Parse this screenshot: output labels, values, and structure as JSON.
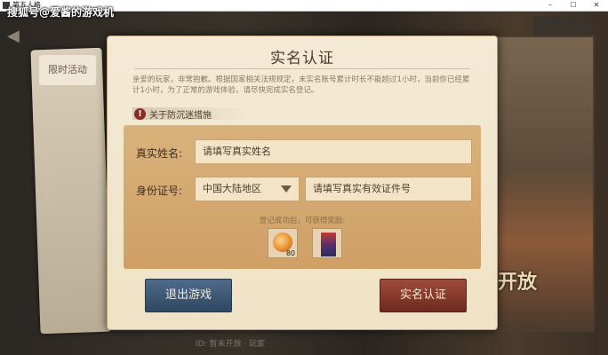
{
  "window": {
    "title": "第五人格",
    "minimize": "–",
    "maximize": "☐",
    "close": "✕"
  },
  "watermark": "搜狐号@爱酱的游戏机",
  "background": {
    "side_tab_label": "限时活动",
    "right_banner_text": "开放",
    "bottom_caption": "ID: 暂未开放 · 玩家"
  },
  "dialog": {
    "title": "实名认证",
    "notice": "亲爱的玩家，非常抱歉。根据国家相关法规规定，未实名账号累计时长不能超过1小时，当前你已经累计1小时，为了正常的游戏体验，请尽快完成实名登记。",
    "warn_icon": "!",
    "warn_label": "关于防沉迷措施",
    "fields": {
      "name_label": "真实姓名:",
      "name_placeholder": "请填写真实姓名",
      "id_label": "身份证号:",
      "region_selected": "中国大陆地区",
      "id_placeholder": "请填写真实有效证件号"
    },
    "reward_caption": "登记成功后，可获得奖励:",
    "rewards": [
      {
        "icon": "coin-icon",
        "qty": "80"
      },
      {
        "icon": "card-icon",
        "qty": ""
      }
    ],
    "buttons": {
      "exit": "退出游戏",
      "confirm": "实名认证"
    }
  }
}
